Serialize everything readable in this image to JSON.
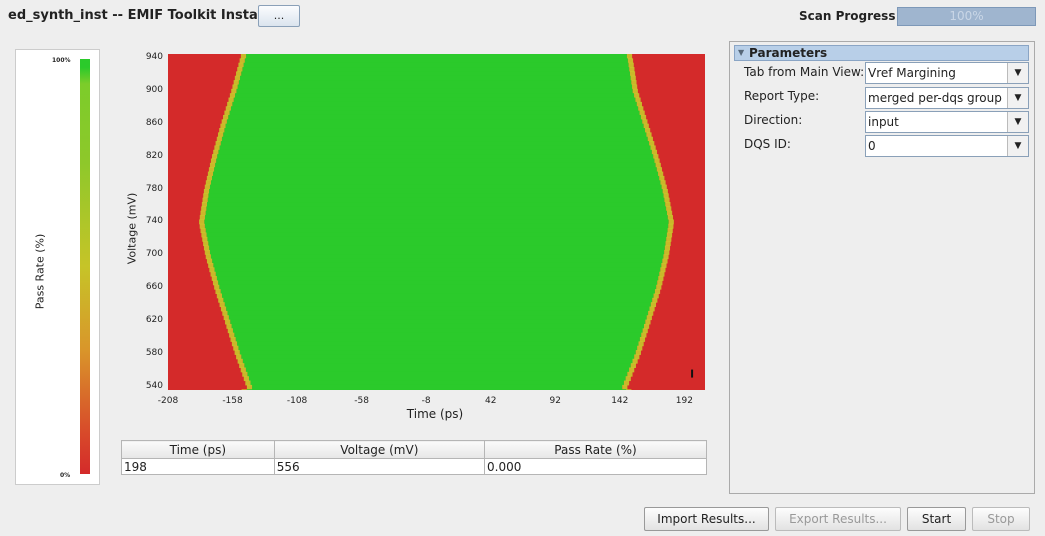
{
  "header": {
    "title": "ed_synth_inst -- EMIF Toolkit Instance",
    "more_button": "...",
    "scan_label": "Scan Progress",
    "scan_progress": "100%",
    "scan_fraction": 1.0
  },
  "legend": {
    "top": "100%",
    "bottom": "0%",
    "label": "Pass Rate (%)"
  },
  "chart_data": {
    "type": "heatmap",
    "xlabel": "Time (ps)",
    "ylabel": "Voltage (mV)",
    "x_ticks": [
      "-208",
      "-158",
      "-108",
      "-58",
      "-8",
      "42",
      "92",
      "142",
      "192"
    ],
    "y_ticks": [
      "940",
      "900",
      "860",
      "820",
      "780",
      "740",
      "700",
      "660",
      "620",
      "580",
      "540"
    ],
    "xlim": [
      -208,
      208
    ],
    "ylim": [
      536,
      945
    ],
    "pass_region": {
      "description_rows": [
        {
          "v": 945,
          "left": -147,
          "right": 147
        },
        {
          "v": 940,
          "left": -148,
          "right": 148
        },
        {
          "v": 900,
          "left": -155,
          "right": 152
        },
        {
          "v": 860,
          "left": -163,
          "right": 160
        },
        {
          "v": 820,
          "left": -170,
          "right": 168
        },
        {
          "v": 780,
          "left": -176,
          "right": 175
        },
        {
          "v": 740,
          "left": -180,
          "right": 180
        },
        {
          "v": 700,
          "left": -175,
          "right": 176
        },
        {
          "v": 660,
          "left": -168,
          "right": 170
        },
        {
          "v": 620,
          "left": -160,
          "right": 162
        },
        {
          "v": 580,
          "left": -152,
          "right": 154
        },
        {
          "v": 540,
          "left": -143,
          "right": 144
        },
        {
          "v": 536,
          "left": -142,
          "right": 143
        }
      ]
    },
    "colors": {
      "pass": "#2bca2b",
      "fail": "#d42a2a",
      "edge": "#c8d02a"
    },
    "cursor": {
      "time": 198,
      "voltage": 556
    }
  },
  "table": {
    "headers": [
      "Time (ps)",
      "Voltage (mV)",
      "Pass Rate (%)"
    ],
    "row": [
      "198",
      "556",
      "0.000"
    ]
  },
  "parameters": {
    "title": "Parameters",
    "fields": [
      {
        "label": "Tab from Main View:",
        "value": "Vref Margining"
      },
      {
        "label": "Report Type:",
        "value": "merged per-dqs group"
      },
      {
        "label": "Direction:",
        "value": "input"
      },
      {
        "label": "DQS ID:",
        "value": "0"
      }
    ]
  },
  "buttons": {
    "import": "Import Results...",
    "export": "Export Results...",
    "start": "Start",
    "stop": "Stop"
  }
}
